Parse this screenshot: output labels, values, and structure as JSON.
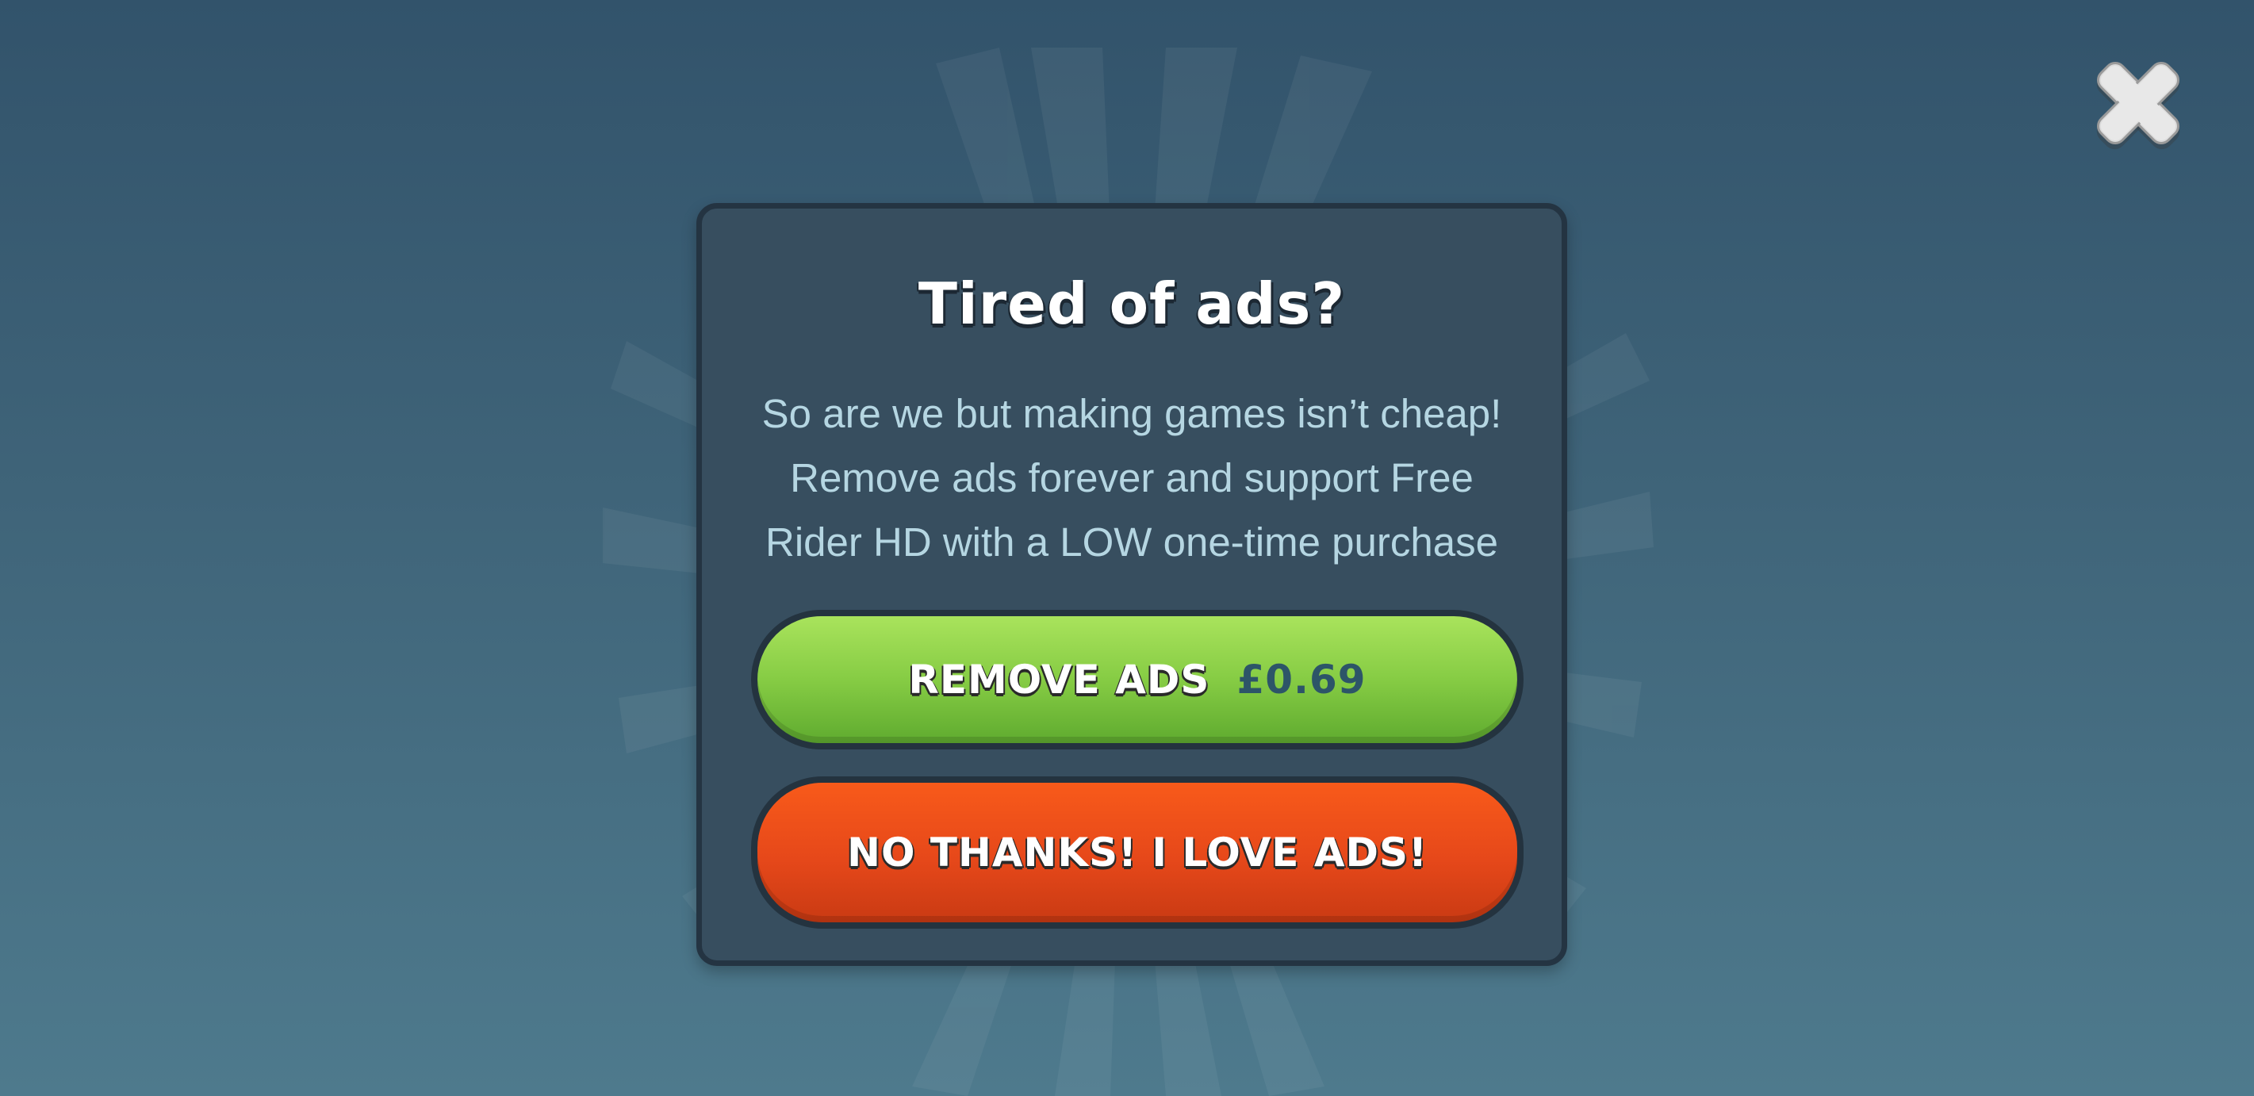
{
  "dialog": {
    "title": "Tired of ads?",
    "body_lines": [
      "So are we but making games isn’t cheap!",
      "Remove ads forever and support Free",
      "Rider HD with a LOW one-time purchase"
    ],
    "remove_ads_label": "REMOVE ADS",
    "remove_ads_price": "£0.69",
    "no_thanks_label": "NO THANKS! I LOVE ADS!"
  },
  "icons": {
    "close": "close-icon"
  },
  "colors": {
    "background_top": "#32536b",
    "background_bottom": "#4e7a8d",
    "dialog_fill": "#374e5f",
    "dialog_border": "#243442",
    "body_text": "#b5d6e2",
    "remove_button": "#86cc44",
    "no_thanks_button": "#e6481a",
    "price_text": "#2d5568"
  }
}
